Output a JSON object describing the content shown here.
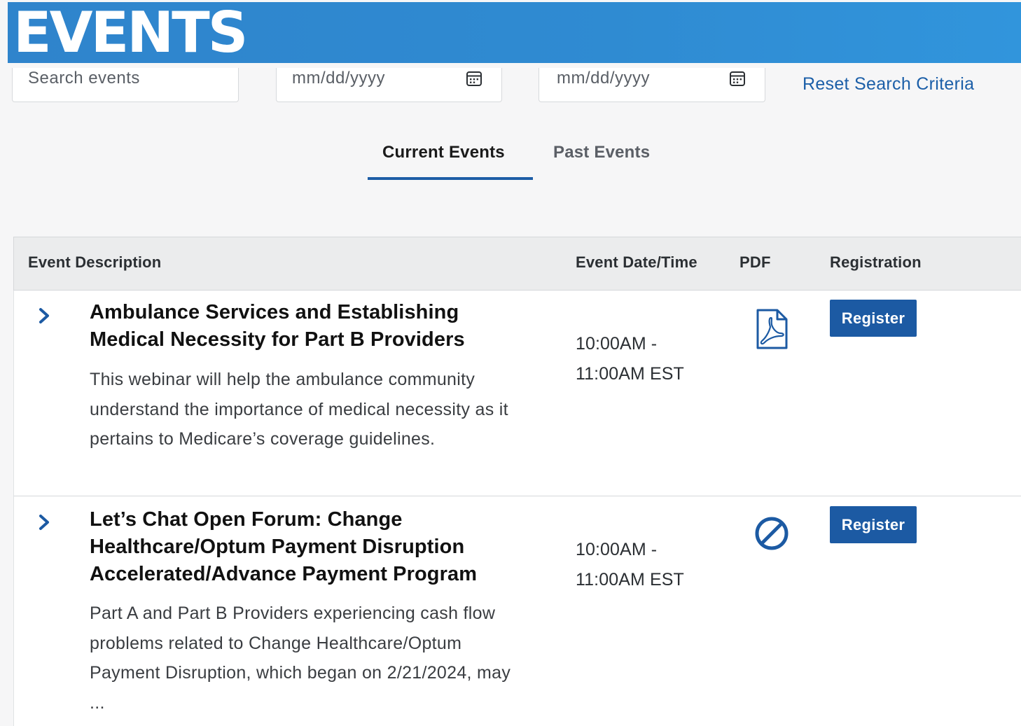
{
  "banner": {
    "title": "EVENTS"
  },
  "filters": {
    "search_placeholder": "Search events",
    "start_date_placeholder": "mm/dd/yyyy",
    "end_date_placeholder": "mm/dd/yyyy",
    "reset_label": "Reset Search Criteria"
  },
  "tabs": [
    {
      "label": "Current Events",
      "active": true
    },
    {
      "label": "Past Events",
      "active": false
    }
  ],
  "table": {
    "headers": {
      "description": "Event Description",
      "datetime": "Event Date/Time",
      "pdf": "PDF",
      "registration": "Registration"
    },
    "rows": [
      {
        "title": "Ambulance Services and Establishing Medical Necessity for Part B Providers",
        "description": "This webinar will help the ambulance community understand the importance of medical necessity as it pertains to Medicare’s coverage guidelines.",
        "time": "10:00AM - 11:00AM EST",
        "pdf_icon": "pdf-file-icon",
        "register_label": "Register"
      },
      {
        "title": "Let’s Chat Open Forum: Change Healthcare/Optum Payment Disruption Accelerated/Advance Payment Program",
        "description": "Part A and Part B Providers experiencing cash flow problems related to Change Healthcare/Optum Payment Disruption, which began on 2/21/2024, may ...",
        "time": "10:00AM - 11:00AM EST",
        "pdf_icon": "not-available-icon",
        "register_label": "Register"
      }
    ]
  },
  "colors": {
    "banner_blue": "#2f8bd2",
    "link_blue": "#1c5fa8",
    "button_blue": "#1c5aa3",
    "tab_underline": "#1d5da6"
  }
}
